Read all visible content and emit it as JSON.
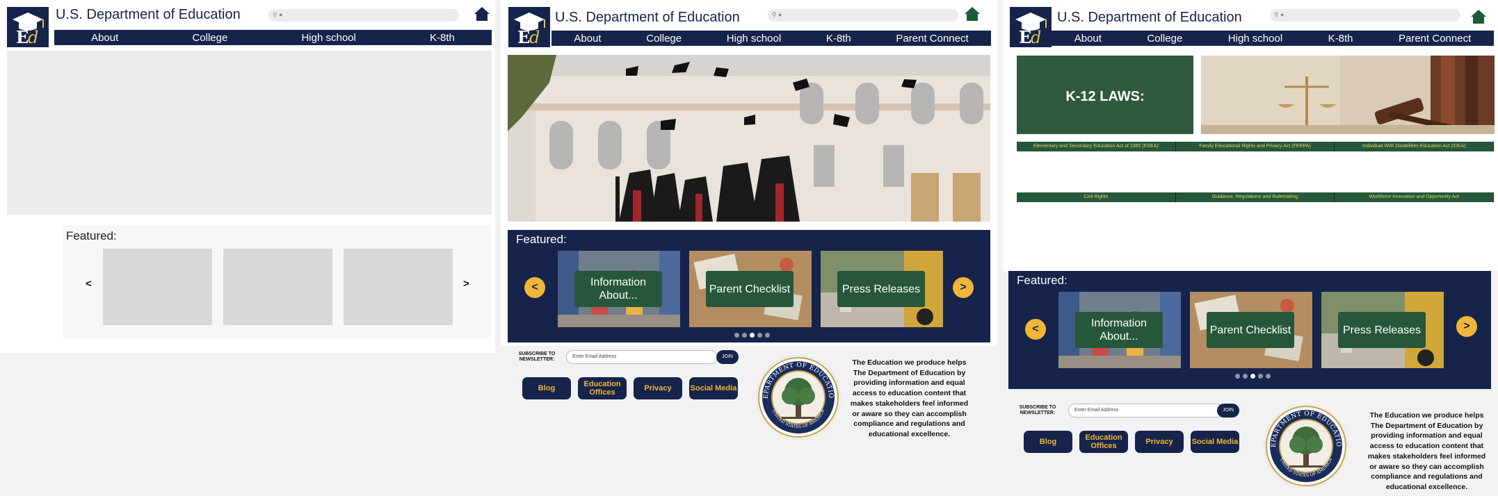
{
  "site": {
    "title": "U.S. Department of  Education",
    "logo_text": "Ed"
  },
  "colors": {
    "navy": "#16234b",
    "gold": "#f0b63a",
    "green": "#26573a"
  },
  "icons": [
    "search-icon",
    "mic-icon",
    "home-icon"
  ],
  "panel1": {
    "nav": [
      "About",
      "College",
      "High school",
      "K-8th"
    ],
    "featured_title": "Featured:",
    "prev": "<",
    "next": ">"
  },
  "panel2": {
    "nav": [
      "About",
      "College",
      "High school",
      "K-8th",
      "Parent Connect"
    ],
    "featured_title": "Featured:",
    "cards": [
      "Information About...",
      "Parent Checklist",
      "Press Releases"
    ],
    "prev": "<",
    "next": ">",
    "active_slide": 3,
    "slides": 5
  },
  "panel3": {
    "nav": [
      "About",
      "College",
      "High school",
      "K-8th",
      "Parent Connect"
    ],
    "laws_heading": "K-12 LAWS:",
    "laws_row1": [
      "Elementary and Secondary Education Act of 1965 (ESEA)",
      "Family Educational Rights and Privacy Act (FERPA)",
      "Individual With Disabilities Education Act (IDEA)"
    ],
    "laws_row2": [
      "Civil Rights",
      "Guidance, Regulations and Rulemaking",
      "Workforce Innovation and Opportunity Act"
    ],
    "featured_title": "Featured:",
    "cards": [
      "Information About...",
      "Parent Checklist",
      "Press Releases"
    ],
    "prev": "<",
    "next": ">"
  },
  "footer": {
    "subscribe": "SUBSCRIBE TO NEWSLETTER:",
    "email_placeholder": "Enter Email Address",
    "join": "JOIN",
    "buttons": [
      "Blog",
      "Education Offices",
      "Privacy",
      "Social Media"
    ],
    "seal_top": "DEPARTMENT OF EDUCATION",
    "seal_bottom": "UNITED STATES OF AMERICA",
    "description": "The Education we produce helps The Department of Education by providing information and equal access to education content that makes stakeholders feel informed or aware so they can accomplish compliance and regulations and educational excellence."
  }
}
